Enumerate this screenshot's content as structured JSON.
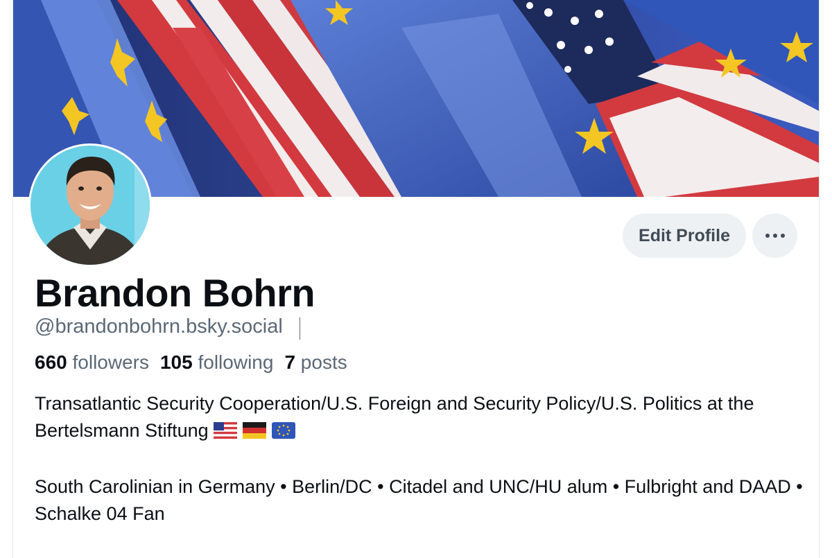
{
  "profile": {
    "name": "Brandon Bohrn",
    "handle": "@brandonbohrn.bsky.social",
    "stats": {
      "followers_count": "660",
      "followers_label": "followers",
      "following_count": "105",
      "following_label": "following",
      "posts_count": "7",
      "posts_label": "posts"
    },
    "bio": {
      "line1": "Transatlantic Security Cooperation/U.S. Foreign and Security Policy/U.S. Politics at the Bertelsmann Stiftung",
      "flags": [
        "us-flag-emoji",
        "germany-flag-emoji",
        "eu-flag-emoji"
      ],
      "line2": "South Carolinian in Germany • Berlin/DC • Citadel and UNC/HU alum • Fulbright and DAAD • Schalke 04 Fan"
    }
  },
  "actions": {
    "edit_profile_label": "Edit Profile",
    "more_icon": "ellipsis-icon"
  },
  "colors": {
    "muted_text": "#5b6876",
    "button_bg": "#eef1f4",
    "button_text": "#414b57",
    "flag_red": "#d23a3f",
    "eu_blue": "#2f56b8",
    "star_yellow": "#f3c623"
  }
}
